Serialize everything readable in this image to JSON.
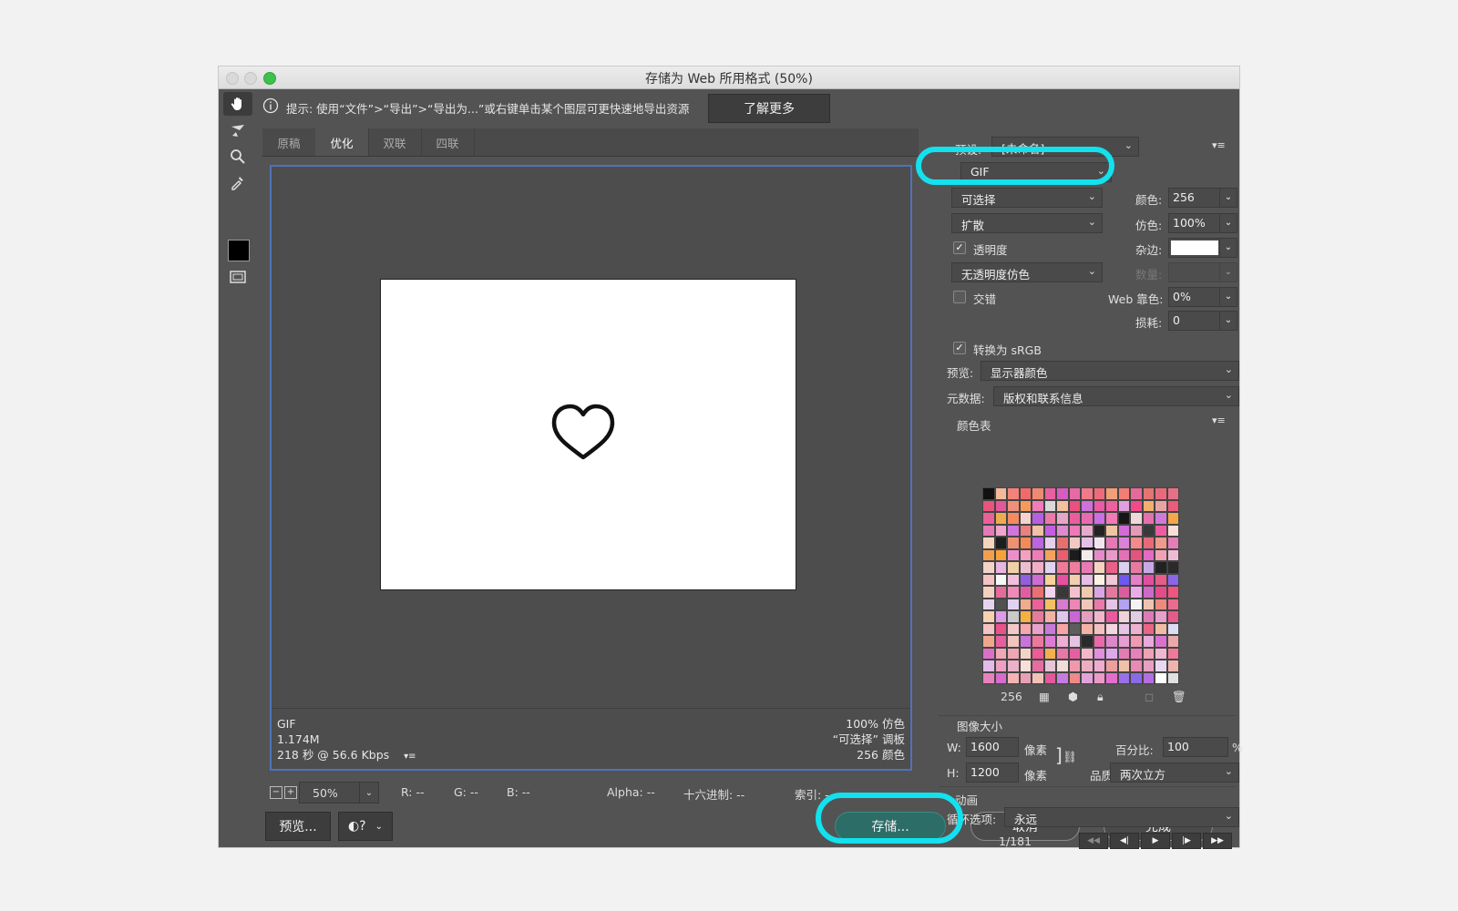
{
  "window": {
    "title": "存储为 Web 所用格式 (50%)"
  },
  "hint": {
    "text": "提示: 使用“文件”>“导出”>“导出为...”或右键单击某个图层可更快速地导出资源",
    "learn_more": "了解更多"
  },
  "tabs": [
    {
      "label": "原稿"
    },
    {
      "label": "优化",
      "active": true
    },
    {
      "label": "双联"
    },
    {
      "label": "四联"
    }
  ],
  "image_info": {
    "format": "GIF",
    "size": "1.174M",
    "time": "218 秒 @ 56.6 Kbps",
    "dither": "100% 仿色",
    "palette": "“可选择” 调板",
    "colors": "256 颜色"
  },
  "status": {
    "zoom": "50%",
    "r": "R: --",
    "g": "G: --",
    "b": "B: --",
    "alpha": "Alpha: --",
    "hex": "十六进制: --",
    "index": "索引: --"
  },
  "buttons": {
    "preview": "预览...",
    "save": "存储...",
    "cancel": "取消",
    "done": "完成"
  },
  "settings": {
    "preset_label": "预设:",
    "preset_value": "[未命名]",
    "format": "GIF",
    "reduction": "可选择",
    "dither_algo": "扩散",
    "transparency_label": "透明度",
    "transparency_checked": true,
    "transparency_dither": "无透明度仿色",
    "interlaced_label": "交错",
    "interlaced_checked": false,
    "colors_label": "颜色:",
    "colors_value": "256",
    "dither_label": "仿色:",
    "dither_value": "100%",
    "matte_label": "杂边:",
    "amount_label": "数量:",
    "web_snap_label": "Web 靠色:",
    "web_snap_value": "0%",
    "lossy_label": "损耗:",
    "lossy_value": "0",
    "convert_srgb_label": "转换为 sRGB",
    "convert_srgb_checked": true,
    "preview_label": "预览:",
    "preview_value": "显示器颜色",
    "metadata_label": "元数据:",
    "metadata_value": "版权和联系信息"
  },
  "color_table": {
    "title": "颜色表",
    "count": "256",
    "colors": [
      "#111111",
      "#f4b89a",
      "#f2837a",
      "#f06a6a",
      "#ef8a72",
      "#e860a0",
      "#d85bc0",
      "#e86aa4",
      "#f07a8a",
      "#ef6b7a",
      "#f0a078",
      "#f27e76",
      "#e66a98",
      "#e67470",
      "#ea6a7c",
      "#e77086",
      "#e9547c",
      "#e2589a",
      "#f0907c",
      "#f59a5c",
      "#f07cba",
      "#d9d9d9",
      "#f3c0a0",
      "#ea5080",
      "#cc72d8",
      "#ea5aa6",
      "#f0609e",
      "#e0a0e0",
      "#f04a8a",
      "#f0b070",
      "#e8a4a4",
      "#e95d7a",
      "#ea609a",
      "#efab50",
      "#f48a62",
      "#f6d2d0",
      "#b85ee0",
      "#ec7aa8",
      "#e5a6c8",
      "#ea5e9e",
      "#e96ab2",
      "#cc6ee6",
      "#ef7cb4",
      "#161616",
      "#f0d8d8",
      "#e470ac",
      "#d07ad8",
      "#f5a648",
      "#e57ab6",
      "#f1a4cc",
      "#d274dc",
      "#ea8080",
      "#f2c0a8",
      "#c45ee0",
      "#dd8ad0",
      "#ef78b8",
      "#e8aacc",
      "#222222",
      "#f0c4a2",
      "#d46ad8",
      "#e39ab8",
      "#393939",
      "#ea5ea0",
      "#f7e0d8",
      "#f5d5bc",
      "#1d1d1d",
      "#ef9274",
      "#f48a58",
      "#b966e0",
      "#e4d0ee",
      "#e96f6f",
      "#f1c8c4",
      "#e4c0e8",
      "#f0e4ee",
      "#e877b8",
      "#d982d8",
      "#f58a8a",
      "#e86a78",
      "#f09a8c",
      "#e37eb8",
      "#f2a050",
      "#f6a23a",
      "#ed8ecc",
      "#f4a0c0",
      "#ed7cb8",
      "#f4a25e",
      "#ea5e70",
      "#1c1c1c",
      "#f3ebeb",
      "#e48cc8",
      "#e99acb",
      "#e670b6",
      "#e4547c",
      "#e46ac4",
      "#f0a2b2",
      "#edbcd4",
      "#f4d2c8",
      "#e8b6e0",
      "#f1cfa6",
      "#eebcd0",
      "#f1aec6",
      "#e0d4f0",
      "#f07a9a",
      "#ee7d9e",
      "#e97ab3",
      "#f6d2c0",
      "#e9618b",
      "#dcd0f0",
      "#e77aa0",
      "#c9a8e8",
      "#222222",
      "#2a2a2a",
      "#f3c2c2",
      "#f7f7f7",
      "#f0c0da",
      "#915ee0",
      "#d06cd6",
      "#f5d29a",
      "#e84fa0",
      "#f0ceb0",
      "#e7bde3",
      "#f9f3e6",
      "#f1c6d6",
      "#6d58f0",
      "#e57fc8",
      "#e34fa0",
      "#e85c8a",
      "#8a66e8",
      "#f4cfc0",
      "#e56c9a",
      "#ed8ab8",
      "#e25ca4",
      "#e97070",
      "#f3d4ee",
      "#383838",
      "#f4c0cc",
      "#efc9b0",
      "#d8a6e6",
      "#e478a0",
      "#dc5ca0",
      "#e8ace8",
      "#d068c8",
      "#e44c88",
      "#ee5580",
      "#e6d2f0",
      "#515151",
      "#e1d1f2",
      "#efab8c",
      "#ea6298",
      "#f2c062",
      "#d67ad2",
      "#ec86b4",
      "#f2c6b6",
      "#e97aac",
      "#e6c2e6",
      "#b2a2f0",
      "#f3f3f3",
      "#edc4b2",
      "#ee8a7c",
      "#eb6b8e",
      "#f6d0b0",
      "#dd9ce4",
      "#cacaca",
      "#f4b040",
      "#e67c9a",
      "#f2b2a6",
      "#e0c6ec",
      "#ca66d6",
      "#e69ec0",
      "#f2b6ca",
      "#ea5aa0",
      "#f2d2da",
      "#e2cce4",
      "#e07ab6",
      "#e7a0cc",
      "#e85a8a",
      "#f3c2c2",
      "#ea528a",
      "#f3c8c8",
      "#f2a8ac",
      "#eaa0cc",
      "#c77ad8",
      "#f6a4a4",
      "#5d5d5d",
      "#f2b2a6",
      "#f5c0c0",
      "#f3d6e0",
      "#e6c4e8",
      "#ecb2d0",
      "#e76684",
      "#f0bca4",
      "#dcdcf4",
      "#efa68c",
      "#e65ea0",
      "#f2c4be",
      "#c874d8",
      "#ec789c",
      "#dd7cd6",
      "#ecaed2",
      "#e4c4e0",
      "#2a2a2a",
      "#e86aa8",
      "#de88cc",
      "#e79ed0",
      "#ef9ab2",
      "#e7aadc",
      "#d872ce",
      "#eaa8a8",
      "#dc70c8",
      "#efa8b4",
      "#eda6b2",
      "#f3d4c4",
      "#ee5c96",
      "#f3b050",
      "#e778a8",
      "#e460a0",
      "#f2b8ca",
      "#e090dc",
      "#dfa8ea",
      "#e67ab2",
      "#e880bc",
      "#efa2b4",
      "#f0b8d0",
      "#ef7a9a",
      "#e2bce8",
      "#f0a0c4",
      "#e9b2c8",
      "#f8e0d8",
      "#e46ea0",
      "#e6c6d6",
      "#f0dcd8",
      "#ee9aac",
      "#ecaec0",
      "#eeacd0",
      "#ef9e9e",
      "#f1c2aa",
      "#e88ab2",
      "#e8a0c2",
      "#e8d8f0",
      "#ecb4ac",
      "#e882bc",
      "#d86ccc",
      "#f4b4b4",
      "#e7a0b6",
      "#f2c2b6",
      "#e05a9c",
      "#c57ce0",
      "#ee8a8a",
      "#e4a2da",
      "#ee9ac8",
      "#e46ecc",
      "#9a70e8",
      "#8a6ae6",
      "#b46ee0",
      "#ffffff",
      "#e0e0e0"
    ],
    "selected_index": 88
  },
  "image_size": {
    "title": "图像大小",
    "w_label": "W:",
    "w_value": "1600",
    "h_label": "H:",
    "h_value": "1200",
    "unit": "像素",
    "percent_label": "百分比:",
    "percent_value": "100",
    "percent_unit": "%",
    "quality_label": "品质:",
    "quality_value": "两次立方"
  },
  "animation": {
    "title": "动画",
    "loop_label": "循环选项:",
    "loop_value": "永远",
    "frame": "1/181"
  },
  "icons": [
    "hand-icon",
    "slice-select-icon",
    "zoom-icon",
    "eyedropper-icon",
    "info-icon",
    "preview-toggle-icon",
    "browser-icon",
    "panel-menu-icon",
    "link-icon",
    "lock-icon",
    "trash-icon"
  ]
}
